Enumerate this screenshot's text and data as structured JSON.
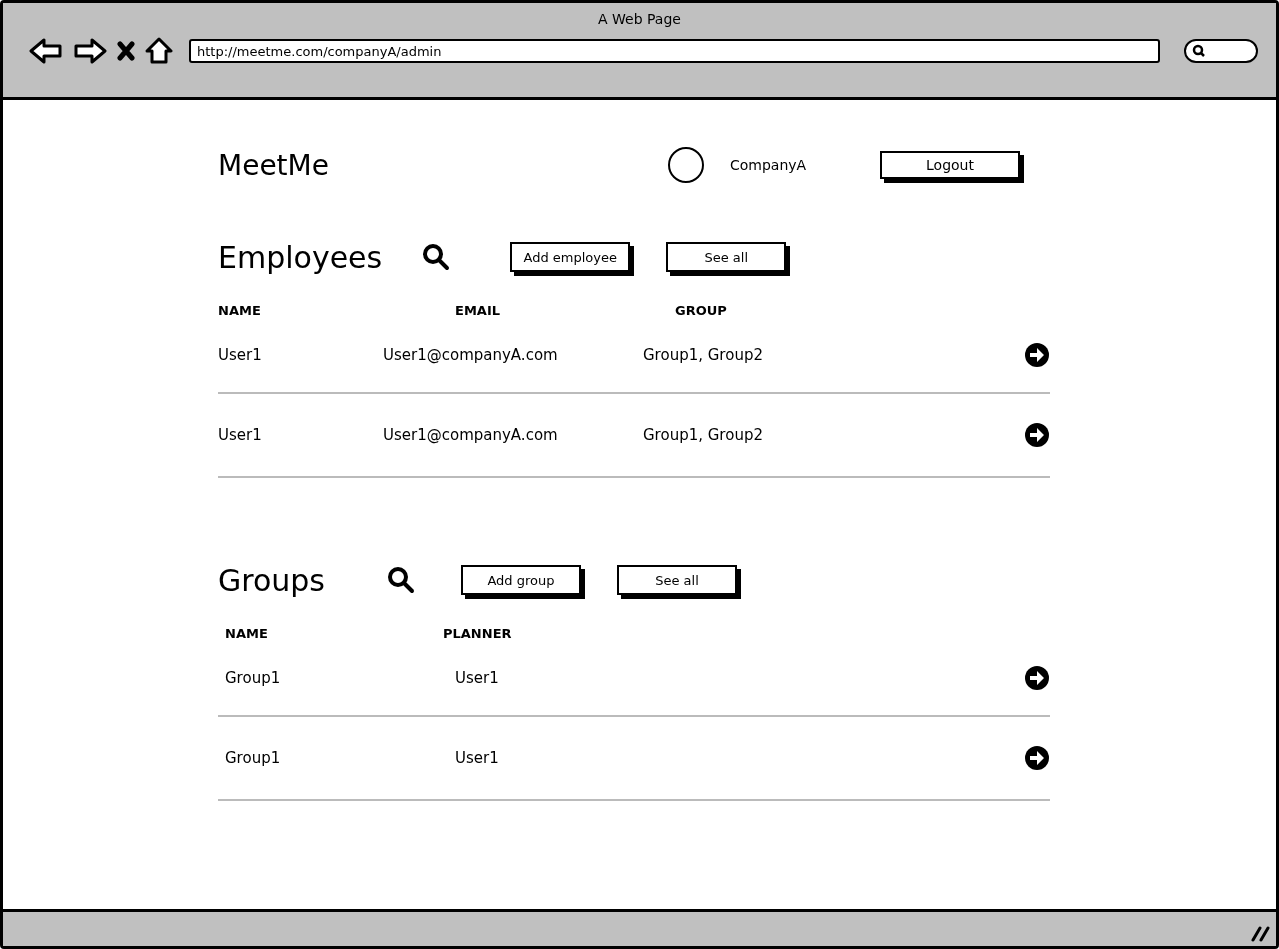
{
  "window": {
    "title": "A Web Page",
    "address": "http://meetme.com/companyA/admin"
  },
  "header": {
    "logo": "MeetMe",
    "account": "CompanyA",
    "logout": "Logout"
  },
  "sections": [
    {
      "title": "Employees",
      "buttons": [
        "Add employee",
        "See all"
      ],
      "columns": [
        "NAME",
        "EMAIL",
        "GROUP"
      ],
      "rows": [
        [
          "User1",
          "User1@companyA.com",
          "Group1, Group2"
        ],
        [
          "User1",
          "User1@companyA.com",
          "Group1, Group2"
        ]
      ]
    },
    {
      "title": "Groups",
      "buttons": [
        "Add group",
        "See all"
      ],
      "columns": [
        "NAME",
        "PLANNER"
      ],
      "rows": [
        [
          "Group1",
          "User1"
        ],
        [
          "Group1",
          "User1"
        ]
      ]
    }
  ]
}
